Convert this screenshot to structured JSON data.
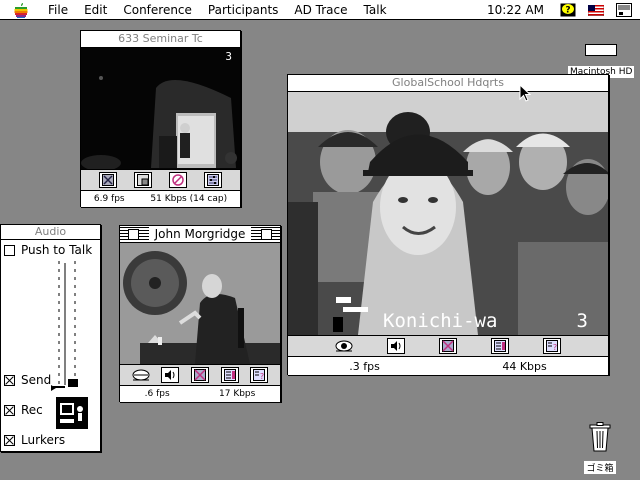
{
  "menubar": {
    "items": [
      "File",
      "Edit",
      "Conference",
      "Participants",
      "AD Trace",
      "Talk"
    ],
    "clock": "10:22 AM"
  },
  "icons": {
    "apple": "apple-icon",
    "help": "help-balloon-icon",
    "keyboard": "us-flag-icon",
    "app": "application-menu-icon"
  },
  "desktop": {
    "disk_label": "Macintosh HD",
    "trash_label": "ゴミ箱"
  },
  "windows": {
    "seminar": {
      "title": "633 Seminar Tc",
      "channel": "3",
      "fps": "6.9 fps",
      "kbps": "51 Kbps (14 cap)"
    },
    "global": {
      "title": "GlobalSchool Hdqrts",
      "overlay_text": "Konichi-wa",
      "channel": "3",
      "fps": ".3 fps",
      "kbps": "44 Kbps"
    },
    "john": {
      "title": "John Morgridge",
      "fps": ".6 fps",
      "kbps": "17 Kbps"
    }
  },
  "audio": {
    "title": "Audio",
    "push_to_talk": "Push to Talk",
    "send": "Send",
    "rec": "Rec",
    "lurkers": "Lurkers"
  }
}
